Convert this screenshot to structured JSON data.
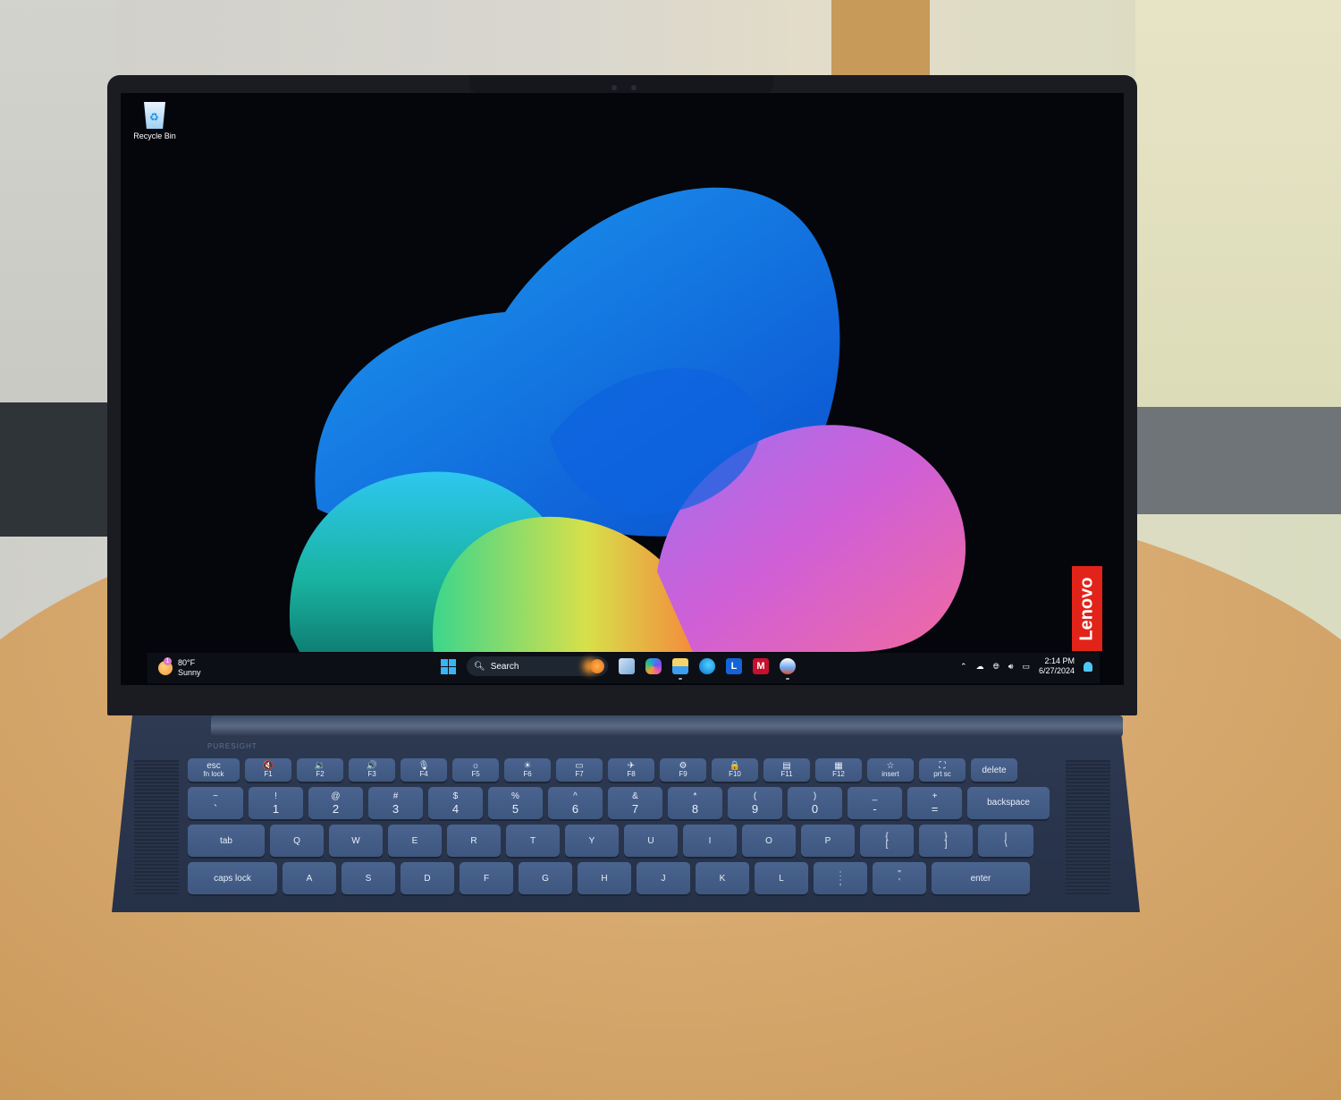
{
  "desktop": {
    "icons": [
      {
        "label": "Recycle Bin",
        "icon": "recycle-bin-icon"
      }
    ],
    "brand_sticker": "Lenovo"
  },
  "taskbar": {
    "weather": {
      "temperature": "80°F",
      "condition": "Sunny",
      "badge": "1"
    },
    "search": {
      "placeholder": "Search"
    },
    "pinned": [
      {
        "name": "task-view",
        "icon": "task-view-icon"
      },
      {
        "name": "copilot",
        "icon": "copilot-icon"
      },
      {
        "name": "file-explorer",
        "icon": "folder-icon",
        "running": true
      },
      {
        "name": "edge",
        "icon": "edge-icon"
      },
      {
        "name": "lenovo-app",
        "icon": "l-app-icon",
        "glyph": "L"
      },
      {
        "name": "mcafee",
        "icon": "mcafee-icon",
        "glyph": "M"
      },
      {
        "name": "app",
        "icon": "app-icon",
        "running": true
      }
    ],
    "tray": {
      "time": "2:14 PM",
      "date": "6/27/2024"
    }
  },
  "laptop": {
    "camera_label": "PURESIGHT"
  },
  "keyboard": {
    "function_row": [
      {
        "top": "esc",
        "bottom": "fn lock"
      },
      {
        "top": "🔇",
        "bottom": "F1"
      },
      {
        "top": "🔉",
        "bottom": "F2"
      },
      {
        "top": "🔊",
        "bottom": "F3"
      },
      {
        "top": "🎙",
        "bottom": "F4"
      },
      {
        "top": "☼",
        "bottom": "F5"
      },
      {
        "top": "☀",
        "bottom": "F6"
      },
      {
        "top": "▭",
        "bottom": "F7"
      },
      {
        "top": "✈",
        "bottom": "F8"
      },
      {
        "top": "⚙",
        "bottom": "F9"
      },
      {
        "top": "🔒",
        "bottom": "F10"
      },
      {
        "top": "▤",
        "bottom": "F11"
      },
      {
        "top": "▦",
        "bottom": "F12"
      },
      {
        "top": "☆",
        "bottom": "insert"
      },
      {
        "top": "⛶",
        "bottom": "prt sc"
      },
      {
        "top": "delete",
        "bottom": ""
      }
    ],
    "number_row": [
      {
        "top": "~",
        "bottom": "`"
      },
      {
        "top": "!",
        "bottom": "1"
      },
      {
        "top": "@",
        "bottom": "2"
      },
      {
        "top": "#",
        "bottom": "3"
      },
      {
        "top": "$",
        "bottom": "4"
      },
      {
        "top": "%",
        "bottom": "5"
      },
      {
        "top": "^",
        "bottom": "6"
      },
      {
        "top": "&",
        "bottom": "7"
      },
      {
        "top": "*",
        "bottom": "8"
      },
      {
        "top": "(",
        "bottom": "9"
      },
      {
        "top": ")",
        "bottom": "0"
      },
      {
        "top": "_",
        "bottom": "-"
      },
      {
        "top": "+",
        "bottom": "="
      },
      {
        "top": "backspace",
        "bottom": ""
      }
    ],
    "qwerty_row": [
      {
        "top": "tab",
        "bottom": ""
      },
      {
        "top": "Q",
        "bottom": ""
      },
      {
        "top": "W",
        "bottom": ""
      },
      {
        "top": "E",
        "bottom": ""
      },
      {
        "top": "R",
        "bottom": ""
      },
      {
        "top": "T",
        "bottom": ""
      },
      {
        "top": "Y",
        "bottom": ""
      },
      {
        "top": "U",
        "bottom": ""
      },
      {
        "top": "I",
        "bottom": ""
      },
      {
        "top": "O",
        "bottom": ""
      },
      {
        "top": "P",
        "bottom": ""
      },
      {
        "top": "{",
        "bottom": "["
      },
      {
        "top": "}",
        "bottom": "]"
      },
      {
        "top": "|",
        "bottom": "\\"
      }
    ],
    "home_row": [
      {
        "top": "caps lock",
        "bottom": ""
      },
      {
        "top": "A",
        "bottom": ""
      },
      {
        "top": "S",
        "bottom": ""
      },
      {
        "top": "D",
        "bottom": ""
      },
      {
        "top": "F",
        "bottom": ""
      },
      {
        "top": "G",
        "bottom": ""
      },
      {
        "top": "H",
        "bottom": ""
      },
      {
        "top": "J",
        "bottom": ""
      },
      {
        "top": "K",
        "bottom": ""
      },
      {
        "top": "L",
        "bottom": ""
      },
      {
        "top": ":",
        "bottom": ";"
      },
      {
        "top": "\"",
        "bottom": "'"
      },
      {
        "top": "enter",
        "bottom": ""
      }
    ]
  }
}
